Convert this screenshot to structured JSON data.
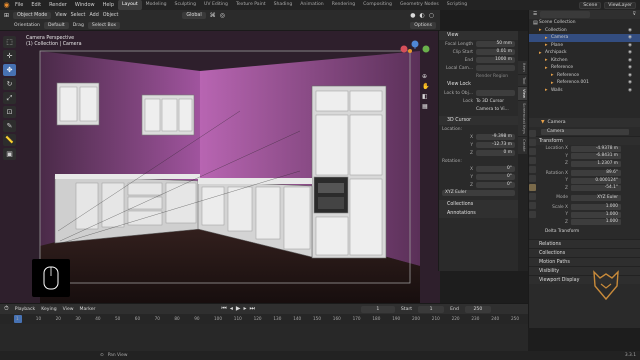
{
  "topbar": {
    "menus": [
      "File",
      "Edit",
      "Render",
      "Window",
      "Help"
    ],
    "workspaces": [
      "Layout",
      "Modeling",
      "Sculpting",
      "UV Editing",
      "Texture Paint",
      "Shading",
      "Animation",
      "Rendering",
      "Compositing",
      "Geometry Nodes",
      "Scripting"
    ],
    "active_workspace": "Layout",
    "scene": "Scene",
    "view_layer": "ViewLayer"
  },
  "viewport_header": {
    "mode": "Object Mode",
    "menus": [
      "View",
      "Select",
      "Add",
      "Object"
    ],
    "transform": "Global",
    "orientation_label": "Orientation",
    "orientation": "Default",
    "drag_label": "Drag",
    "drag": "Select Box",
    "options": "Options"
  },
  "overlay_text": {
    "line1": "Camera Perspective",
    "line2": "(1) Collection | Camera"
  },
  "npanel": {
    "view_title": "View",
    "focal_length_label": "Focal Length",
    "focal_length": "50 mm",
    "clip_start_label": "Clip Start",
    "clip_start": "0.01 m",
    "clip_end_label": "End",
    "clip_end": "1000 m",
    "local_camera_label": "Local Cam...",
    "render_region": "Render Region",
    "view_lock": "View Lock",
    "lock_to_object_label": "Lock to Obj...",
    "lock_label": "Lock",
    "to_3d_cursor": "To 3D Cursor",
    "camera_to_view": "Camera to Vi...",
    "cursor_title": "3D Cursor",
    "location_label": "Location:",
    "cursor_x": "-9.398 m",
    "cursor_y": "-12.73 m",
    "cursor_z": "0 m",
    "rotation_label": "Rotation:",
    "rot_x": "0°",
    "rot_y": "0°",
    "rot_z": "0°",
    "rot_mode": "XYZ Euler",
    "collections": "Collections",
    "annotations": "Annotations",
    "tabs": [
      "Item",
      "Tool",
      "View",
      "Screencast Keys",
      "Create"
    ]
  },
  "outliner": {
    "title": "Scene Collection",
    "items": [
      {
        "name": "Collection",
        "level": 1,
        "selected": false
      },
      {
        "name": "Camera",
        "level": 2,
        "selected": true
      },
      {
        "name": "Plane",
        "level": 2,
        "selected": false
      },
      {
        "name": "Archipack",
        "level": 1,
        "selected": false
      },
      {
        "name": "Kitchen",
        "level": 2,
        "selected": false
      },
      {
        "name": "Reference",
        "level": 2,
        "selected": false
      },
      {
        "name": "Reference",
        "level": 3,
        "selected": false
      },
      {
        "name": "Reference.001",
        "level": 3,
        "selected": false
      },
      {
        "name": "Walls",
        "level": 2,
        "selected": false
      }
    ]
  },
  "properties": {
    "object_name": "Camera",
    "object_field": "Camera",
    "transform": "Transform",
    "location_label": "Location X",
    "loc": [
      "-4.9378 m",
      "-6.8431 m",
      "1.2307 m"
    ],
    "rotation_label": "Rotation X",
    "rot": [
      "89.6°",
      "0.000124°",
      "-54.1°"
    ],
    "mode_label": "Mode",
    "mode": "XYZ Euler",
    "scale_label": "Scale X",
    "scale": [
      "1.000",
      "1.000",
      "1.000"
    ],
    "delta": "Delta Transform",
    "sections": [
      "Relations",
      "Collections",
      "Motion Paths",
      "Visibility",
      "Viewport Display"
    ]
  },
  "timeline": {
    "menus": [
      "Playback",
      "Keying",
      "View",
      "Marker"
    ],
    "current_frame": "1",
    "start_label": "Start",
    "start": "1",
    "end_label": "End",
    "end": "250",
    "ruler": [
      "1",
      "10",
      "20",
      "30",
      "40",
      "50",
      "60",
      "70",
      "80",
      "90",
      "100",
      "110",
      "120",
      "130",
      "140",
      "150",
      "160",
      "170",
      "180",
      "190",
      "200",
      "210",
      "220",
      "230",
      "240",
      "250"
    ]
  },
  "statusbar": {
    "hint": "Pan View",
    "version": "3.3.1"
  },
  "colors": {
    "accent": "#4772b3",
    "wall": "#b45fb0",
    "floor": "#2a1a1a"
  }
}
